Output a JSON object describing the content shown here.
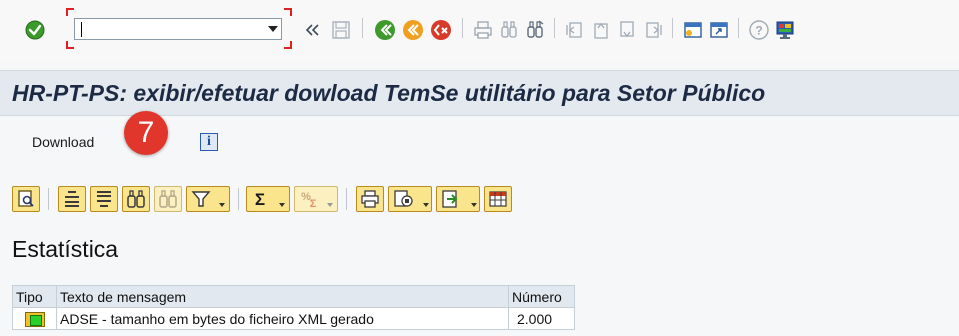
{
  "command_field": {
    "value": "",
    "placeholder": ""
  },
  "system_toolbar": {
    "icons": [
      "enter-check-icon",
      "command-field-dropdown-icon",
      "collapse-double-chevron-icon",
      "save-icon",
      "back-icon",
      "exit-icon",
      "cancel-icon",
      "print-icon",
      "find-icon",
      "find-next-icon",
      "first-page-icon",
      "previous-page-icon",
      "next-page-icon",
      "last-page-icon",
      "create-session-icon",
      "shortcut-icon",
      "help-icon",
      "customize-layout-icon"
    ]
  },
  "title": {
    "text": "HR-PT-PS: exibir/efetuar dowload TemSe utilitário para Setor Público"
  },
  "app_toolbar": {
    "download_label": "Download",
    "step_badge": "7",
    "info_label": "i"
  },
  "alv_toolbar": {
    "icons": [
      "details-icon",
      "sort-ascending-icon",
      "sort-descending-icon",
      "find-icon",
      "find-next-icon",
      "filter-icon",
      "total-icon",
      "subtotal-icon",
      "print-preview-icon",
      "view-icon",
      "export-icon",
      "layout-icon"
    ]
  },
  "section": {
    "title": "Estatística"
  },
  "table": {
    "headers": {
      "type": "Tipo",
      "text": "Texto de mensagem",
      "number": "Número"
    },
    "rows": [
      {
        "status": "green-light-icon",
        "text": "ADSE - tamanho em bytes do ficheiro XML gerado",
        "number": "2.000"
      }
    ]
  },
  "colors": {
    "badge": "#e0362b",
    "title_text": "#1c2a44",
    "status_ok": "#2bd12b"
  }
}
